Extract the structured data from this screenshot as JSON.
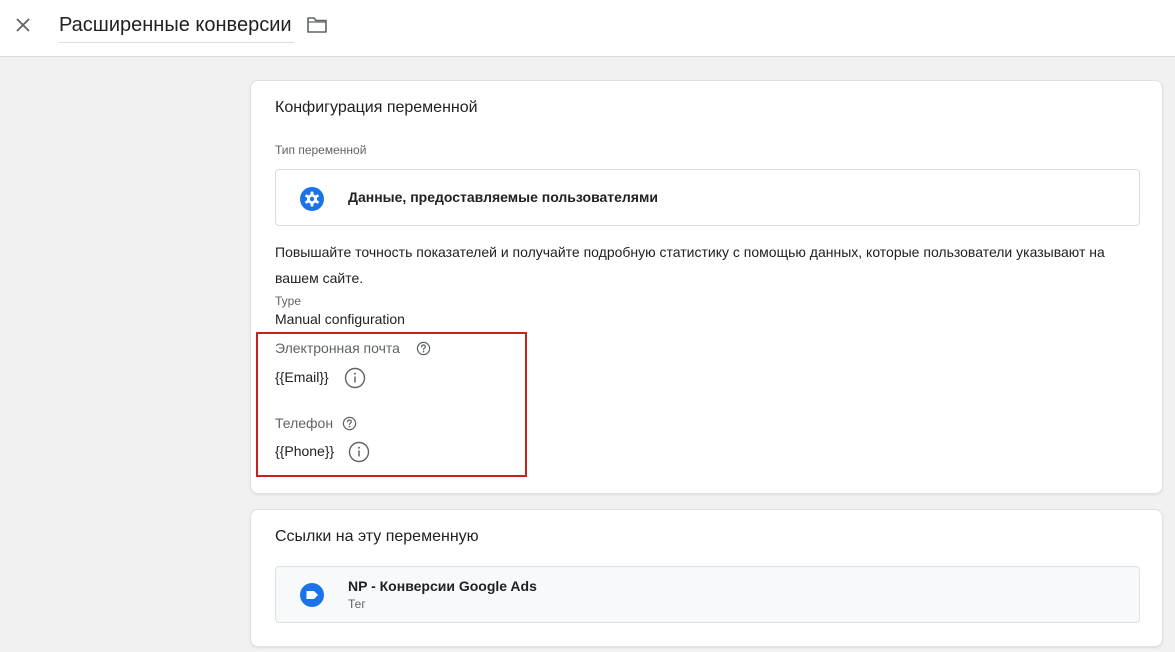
{
  "header": {
    "title": "Расширенные конверсии",
    "close_icon": "close-icon",
    "folder_icon": "folder-icon"
  },
  "config": {
    "title": "Конфигурация переменной",
    "type_label": "Тип переменной",
    "type_name": "Данные, предоставляемые пользователями",
    "type_icon": "gear-icon",
    "description": "Повышайте точность показателей и получайте подробную статистику с помощью данных, которые пользователи указывают на вашем сайте.",
    "mode_label": "Type",
    "mode_value": "Manual configuration",
    "fields": [
      {
        "label": "Электронная почта",
        "value": "{{Email}}"
      },
      {
        "label": "Телефон",
        "value": "{{Phone}}"
      }
    ],
    "highlight_color": "#cc1f1f"
  },
  "references": {
    "title": "Ссылки на эту переменную",
    "items": [
      {
        "name": "NP - Конверсии Google Ads",
        "kind": "Тег",
        "icon": "tag-icon"
      }
    ]
  },
  "colors": {
    "accent": "#1a73e8",
    "background": "#f1f1f1"
  }
}
